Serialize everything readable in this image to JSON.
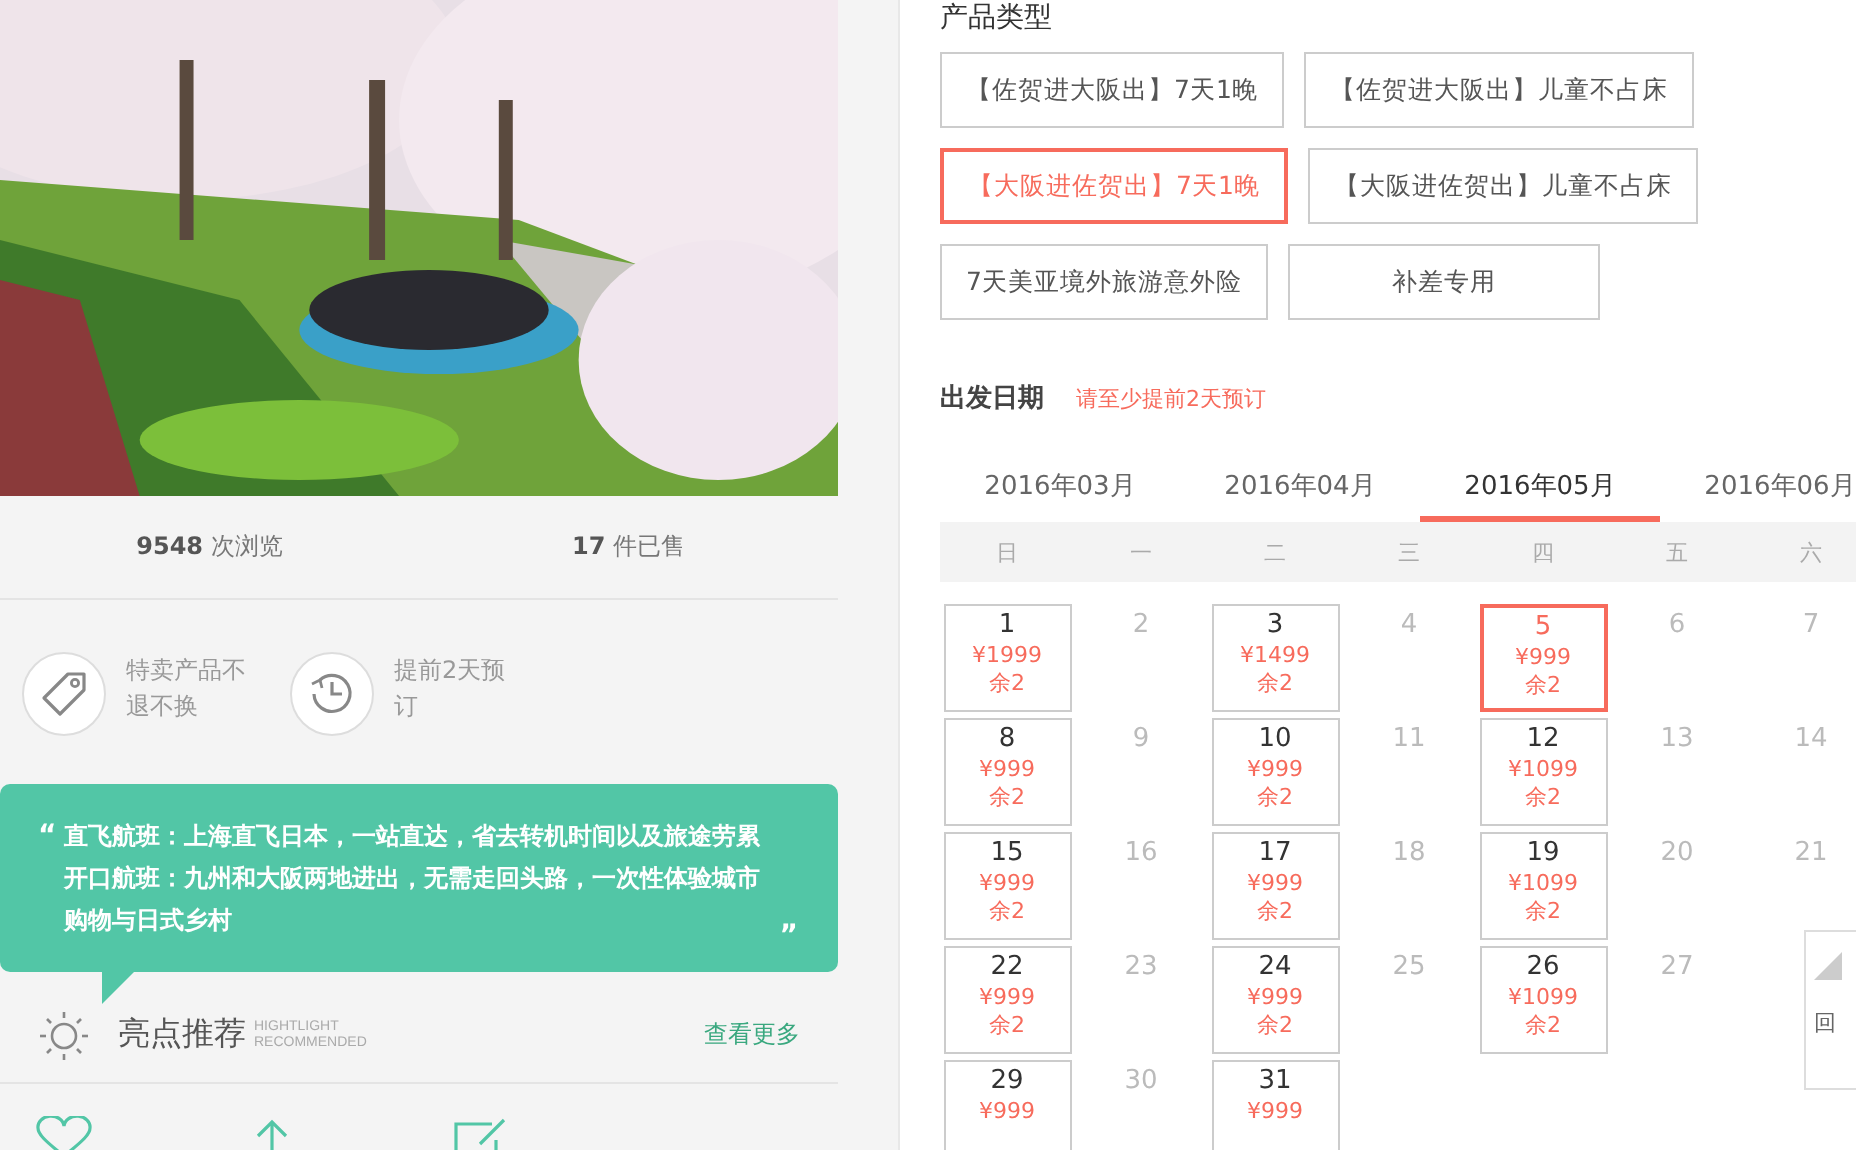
{
  "photo": {
    "kind": "picture"
  },
  "stats": [
    "**9548** 次浏览",
    "**17** 件已售"
  ],
  "features": [
    {
      "kind": "tag",
      "text": "特卖产品不退不换"
    },
    {
      "kind": "clock",
      "text": "提前2天预订"
    }
  ],
  "quote": {
    "open": "“",
    "close": "”",
    "lines": [
      "直飞航班：上海直飞日本，一站直达，省去转机时间以及旅途劳累",
      "开口航班：九州和大阪两地进出，无需走回头路，一次性体验城市购物与日式乡村"
    ]
  },
  "highlight": {
    "title": "亮点推荐",
    "subtitle": [
      "HIGHTLIGHT",
      "RECOMMENDED"
    ],
    "more": "查看更多"
  },
  "product_section": {
    "title": "产品类型",
    "options": [
      {
        "label": "【佐贺进大阪出】7天1晚",
        "selected": false
      },
      {
        "label": "【佐贺进大阪出】儿童不占床",
        "selected": false
      },
      {
        "label": "【大阪进佐贺出】7天1晚",
        "selected": true
      },
      {
        "label": "【大阪进佐贺出】儿童不占床",
        "selected": false
      },
      {
        "label": "7天美亚境外旅游意外险",
        "selected": false
      },
      {
        "label": "补差专用",
        "selected": false
      }
    ]
  },
  "departure": {
    "title": "出发日期",
    "note": "请至少提前2天预订"
  },
  "months": [
    {
      "label": "2016年03月",
      "selected": false
    },
    {
      "label": "2016年04月",
      "selected": false
    },
    {
      "label": "2016年05月",
      "selected": true
    },
    {
      "label": "2016年06月",
      "selected": false
    }
  ],
  "weekdays": [
    "日",
    "一",
    "二",
    "三",
    "四",
    "五",
    "六"
  ],
  "weeks": [
    [
      {
        "day": "1",
        "price": "¥1999",
        "remaining": "余2",
        "available": true,
        "selected": false
      },
      {
        "day": "2",
        "available": false
      },
      {
        "day": "3",
        "price": "¥1499",
        "remaining": "余2",
        "available": true,
        "selected": false
      },
      {
        "day": "4",
        "available": false
      },
      {
        "day": "5",
        "price": "¥999",
        "remaining": "余2",
        "available": true,
        "selected": true
      },
      {
        "day": "6",
        "available": false
      },
      {
        "day": "7",
        "available": false
      }
    ],
    [
      {
        "day": "8",
        "price": "¥999",
        "remaining": "余2",
        "available": true,
        "selected": false
      },
      {
        "day": "9",
        "available": false
      },
      {
        "day": "10",
        "price": "¥999",
        "remaining": "余2",
        "available": true,
        "selected": false
      },
      {
        "day": "11",
        "available": false
      },
      {
        "day": "12",
        "price": "¥1099",
        "remaining": "余2",
        "available": true,
        "selected": false
      },
      {
        "day": "13",
        "available": false
      },
      {
        "day": "14",
        "available": false
      }
    ],
    [
      {
        "day": "15",
        "price": "¥999",
        "remaining": "余2",
        "available": true,
        "selected": false
      },
      {
        "day": "16",
        "available": false
      },
      {
        "day": "17",
        "price": "¥999",
        "remaining": "余2",
        "available": true,
        "selected": false
      },
      {
        "day": "18",
        "available": false
      },
      {
        "day": "19",
        "price": "¥1099",
        "remaining": "余2",
        "available": true,
        "selected": false
      },
      {
        "day": "20",
        "available": false
      },
      {
        "day": "21",
        "available": false
      }
    ],
    [
      {
        "day": "22",
        "price": "¥999",
        "remaining": "余2",
        "available": true,
        "selected": false
      },
      {
        "day": "23",
        "available": false
      },
      {
        "day": "24",
        "price": "¥999",
        "remaining": "余2",
        "available": true,
        "selected": false
      },
      {
        "day": "25",
        "available": false
      },
      {
        "day": "26",
        "price": "¥1099",
        "remaining": "余2",
        "available": true,
        "selected": false
      },
      {
        "day": "27",
        "available": false
      }
    ],
    [
      {
        "day": "29",
        "price": "¥999",
        "available": true,
        "selected": false
      },
      {
        "day": "30",
        "available": false
      },
      {
        "day": "31",
        "price": "¥999",
        "available": true,
        "selected": false
      }
    ]
  ],
  "back_to_top": {
    "label": "回"
  }
}
